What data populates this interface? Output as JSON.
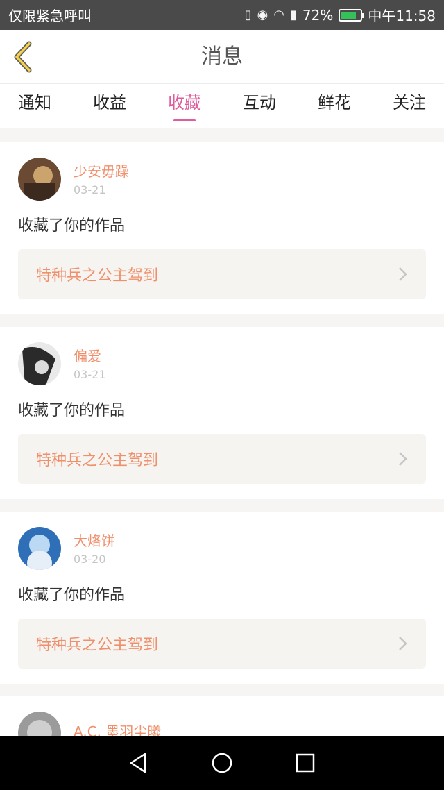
{
  "status_bar": {
    "left_text": "仅限紧急呼叫",
    "battery": "72%",
    "time": "中午11:58"
  },
  "nav": {
    "title": "消息"
  },
  "tabs": [
    {
      "label": "通知",
      "active": false
    },
    {
      "label": "收益",
      "active": false
    },
    {
      "label": "收藏",
      "active": true
    },
    {
      "label": "互动",
      "active": false
    },
    {
      "label": "鲜花",
      "active": false
    },
    {
      "label": "关注",
      "active": false
    }
  ],
  "messages": [
    {
      "user": "少安毋躁",
      "date": "03-21",
      "text": "收藏了你的作品",
      "work": "特种兵之公主驾到"
    },
    {
      "user": "偏爱",
      "date": "03-21",
      "text": "收藏了你的作品",
      "work": "特种兵之公主驾到"
    },
    {
      "user": "大烙饼",
      "date": "03-20",
      "text": "收藏了你的作品",
      "work": "特种兵之公主驾到"
    },
    {
      "user": "A.C. 墨羽尘曦",
      "date": "",
      "text": "",
      "work": ""
    }
  ],
  "colors": {
    "accent": "#e05d9d",
    "orange": "#f08f6b"
  }
}
